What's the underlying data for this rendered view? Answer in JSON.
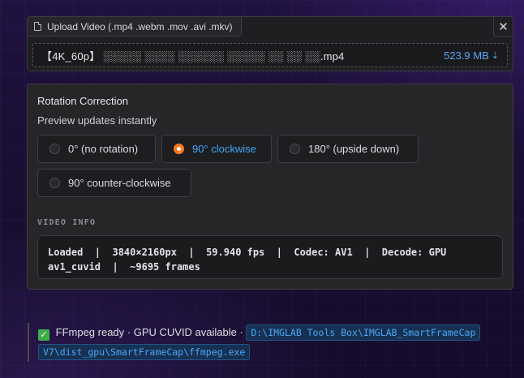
{
  "upload": {
    "tab_label": "Upload Video (.mp4 .webm .mov .avi .mkv)",
    "close_glyph": "✕",
    "file_name": "【4K_60p】 ░░░░░ ░░░░ ░░░░░░ ░░░░░ ░░ ░░ ░░.mp4",
    "file_size": "523.9 MB",
    "download_glyph": "⇣"
  },
  "rotation": {
    "title": "Rotation Correction",
    "subtitle": "Preview updates instantly",
    "options": [
      {
        "label": "0° (no rotation)",
        "selected": false
      },
      {
        "label": "90° clockwise",
        "selected": true
      },
      {
        "label": "180° (upside down)",
        "selected": false
      },
      {
        "label": "90° counter-clockwise",
        "selected": false
      }
    ]
  },
  "video_info": {
    "label": "VIDEO INFO",
    "text": "Loaded  |  3840×2160px  |  59.940 fps  |  Codec: AV1  |  Decode: GPU\nav1_cuvid  |  ~9695 frames"
  },
  "status": {
    "check_glyph": "✓",
    "text": "FFmpeg ready · GPU CUVID available ·",
    "path": "D:\\IMGLAB Tools Box\\IMGLAB_SmartFrameCap V7\\dist_gpu\\SmartFrameCap\\ffmpeg.exe"
  },
  "colors": {
    "accent_blue": "#40a6f6",
    "radio_selected": "#ff7a1f",
    "check_green": "#3fae49"
  }
}
